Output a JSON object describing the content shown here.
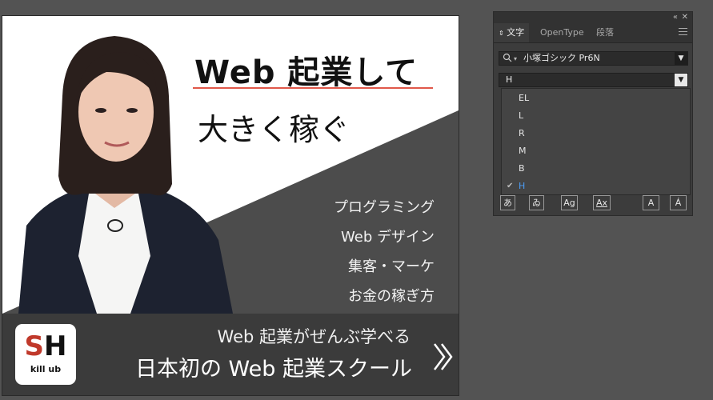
{
  "banner": {
    "headline_line1": "Web 起業して",
    "headline_line2": "大きく稼ぐ",
    "features": [
      "プログラミング",
      "Web デザイン",
      "集客・マーケ",
      "お金の稼ぎ方"
    ],
    "tagline": "Web 起業がぜんぶ学べる",
    "school_name": "日本初の Web 起業スクール",
    "logo": {
      "letter_s": "S",
      "letter_h": "H",
      "sub": "kill ub"
    },
    "colors": {
      "dark": "#3b3b3b",
      "triangle": "#4c4c4c",
      "logo_red": "#c0392b",
      "underline": "#e0584a"
    }
  },
  "character_panel": {
    "tabs": [
      "文字",
      "OpenType",
      "段落"
    ],
    "font_family": "小塚ゴシック Pr6N",
    "font_style": "H",
    "style_options": [
      "EL",
      "L",
      "R",
      "M",
      "B",
      "H"
    ],
    "selected_option": "H",
    "check_mark": "✔",
    "tool_icons": [
      "あ",
      "ゐ",
      "Ag",
      "Ax",
      "A",
      "Á"
    ],
    "icons": {
      "collapse": "collapse-icon",
      "close": "close-icon",
      "menu": "menu-icon",
      "search": "search-icon",
      "chevron": "chevron-down-icon"
    }
  }
}
